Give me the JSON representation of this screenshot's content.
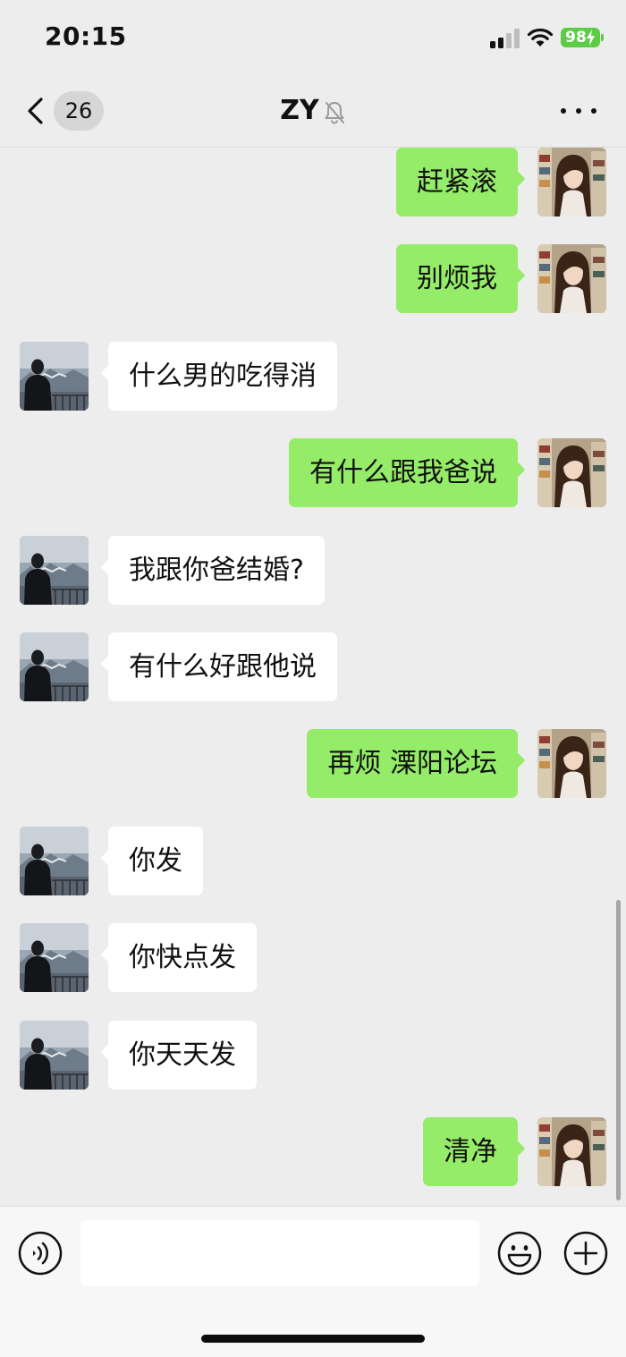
{
  "status_bar": {
    "time": "20:15",
    "battery_percent": "98",
    "charging": true,
    "signal_bars": 2,
    "signal_bars_total": 4,
    "wifi": "wifi-icon"
  },
  "nav": {
    "back_icon": "chevron-left-icon",
    "unread_count": "26",
    "title": "ZY",
    "muted_icon": "bell-muted-icon",
    "more_icon": "more-dots-icon"
  },
  "messages": [
    {
      "sender": "me",
      "text": "赶紧滚"
    },
    {
      "sender": "me",
      "text": "别烦我"
    },
    {
      "sender": "other",
      "text": "什么男的吃得消"
    },
    {
      "sender": "me",
      "text": "有什么跟我爸说"
    },
    {
      "sender": "other",
      "text": "我跟你爸结婚?"
    },
    {
      "sender": "other",
      "text": "有什么好跟他说"
    },
    {
      "sender": "me",
      "text": "再烦 溧阳论坛"
    },
    {
      "sender": "other",
      "text": "你发"
    },
    {
      "sender": "other",
      "text": "你快点发"
    },
    {
      "sender": "other",
      "text": "你天天发"
    },
    {
      "sender": "me",
      "text": "清净"
    }
  ],
  "input_bar": {
    "voice_icon": "voice-icon",
    "text_value": "",
    "emoji_icon": "emoji-icon",
    "plus_icon": "plus-icon"
  },
  "colors": {
    "background": "#ededed",
    "outgoing_bubble": "#95ec69",
    "incoming_bubble": "#ffffff",
    "battery": "#5ccb45"
  }
}
